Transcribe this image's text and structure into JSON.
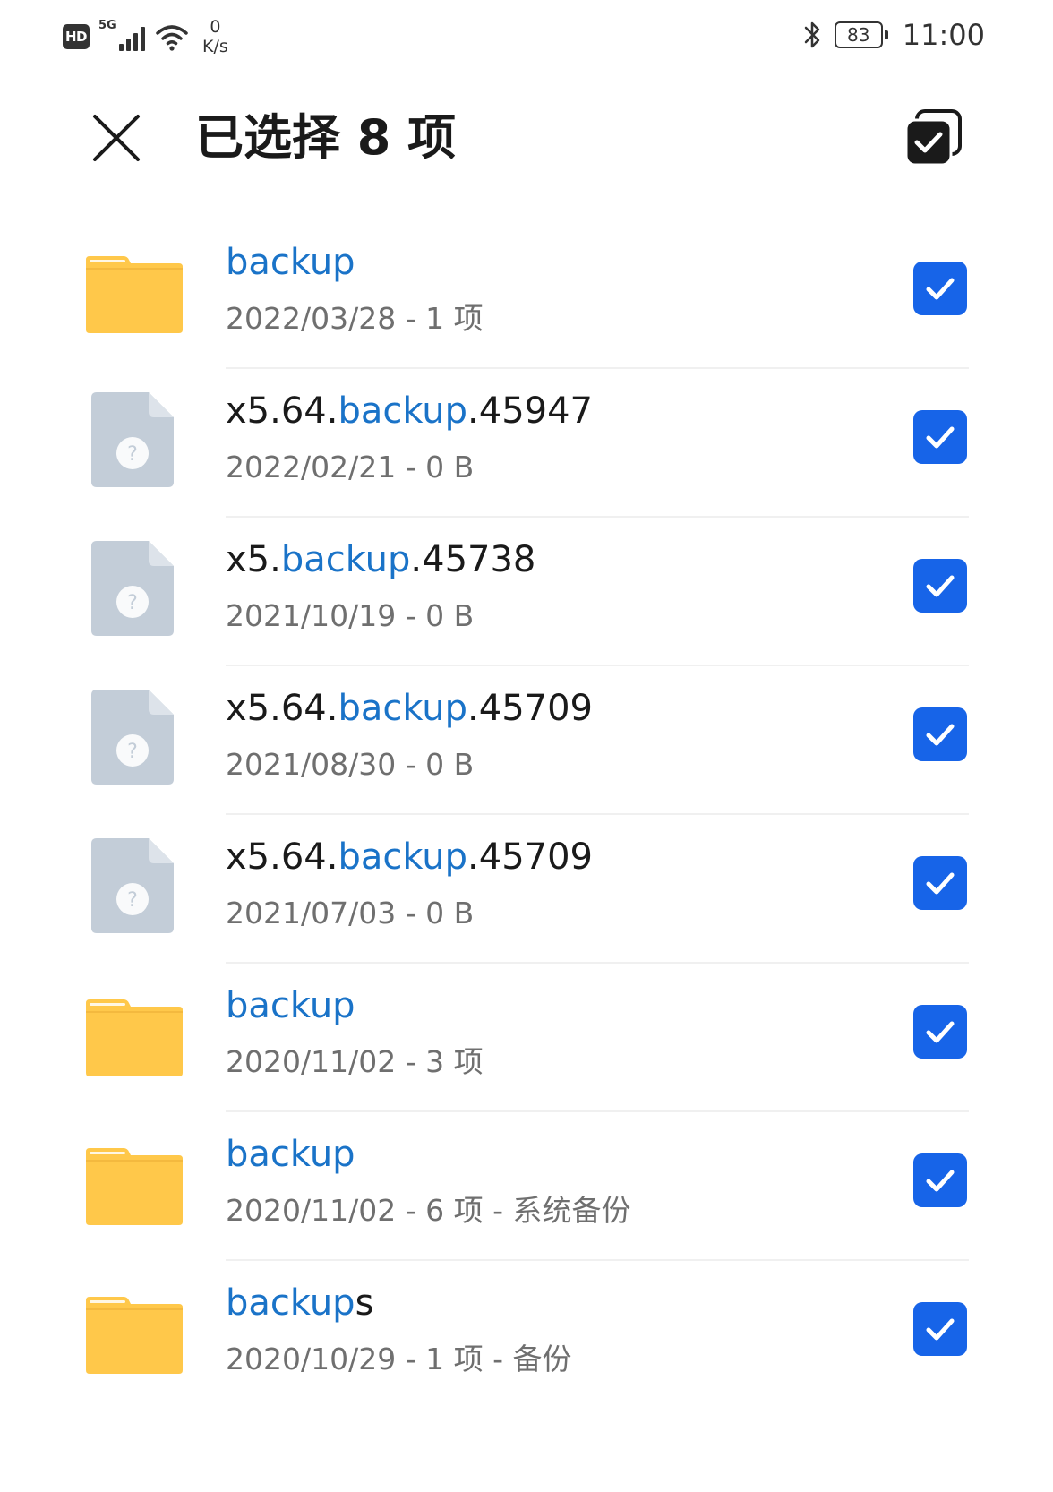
{
  "status_bar": {
    "hd_label": "HD",
    "network_label": "5G",
    "speed_value": "0",
    "speed_unit": "K/s",
    "battery_level": "83",
    "time": "11:00"
  },
  "header": {
    "title": "已选择 8 项",
    "close_icon": "close-icon",
    "select_all_icon": "select-all-checked-icon"
  },
  "colors": {
    "accent_blue": "#1764e8",
    "highlight_blue": "#1a73c8",
    "folder_yellow": "#ffc84a",
    "file_gray": "#c3cdd8"
  },
  "files": [
    {
      "type": "folder",
      "name_parts": [
        {
          "text": "backup",
          "hl": true
        }
      ],
      "meta": "2022/03/28 - 1 项",
      "checked": true
    },
    {
      "type": "unknown-file",
      "name_parts": [
        {
          "text": "x5.64.",
          "hl": false
        },
        {
          "text": "backup",
          "hl": true
        },
        {
          "text": ".45947",
          "hl": false
        }
      ],
      "meta": "2022/02/21 - 0 B",
      "checked": true
    },
    {
      "type": "unknown-file",
      "name_parts": [
        {
          "text": "x5.",
          "hl": false
        },
        {
          "text": "backup",
          "hl": true
        },
        {
          "text": ".45738",
          "hl": false
        }
      ],
      "meta": "2021/10/19 - 0 B",
      "checked": true
    },
    {
      "type": "unknown-file",
      "name_parts": [
        {
          "text": "x5.64.",
          "hl": false
        },
        {
          "text": "backup",
          "hl": true
        },
        {
          "text": ".45709",
          "hl": false
        }
      ],
      "meta": "2021/08/30 - 0 B",
      "checked": true
    },
    {
      "type": "unknown-file",
      "name_parts": [
        {
          "text": "x5.64.",
          "hl": false
        },
        {
          "text": "backup",
          "hl": true
        },
        {
          "text": ".45709",
          "hl": false
        }
      ],
      "meta": "2021/07/03 - 0 B",
      "checked": true
    },
    {
      "type": "folder",
      "name_parts": [
        {
          "text": "backup",
          "hl": true
        }
      ],
      "meta": "2020/11/02 - 3 项",
      "checked": true
    },
    {
      "type": "folder",
      "name_parts": [
        {
          "text": "backup",
          "hl": true
        }
      ],
      "meta": "2020/11/02 - 6 项 - 系统备份",
      "checked": true
    },
    {
      "type": "folder",
      "name_parts": [
        {
          "text": "backup",
          "hl": true
        },
        {
          "text": "s",
          "hl": false
        }
      ],
      "meta": "2020/10/29 - 1 项 - 备份",
      "checked": true
    }
  ]
}
